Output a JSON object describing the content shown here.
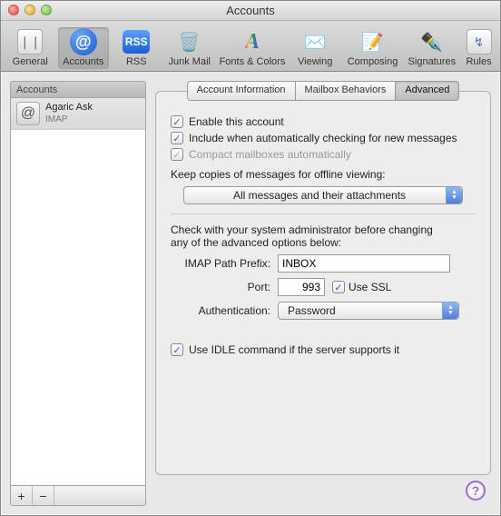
{
  "window": {
    "title": "Accounts"
  },
  "toolbar": {
    "items": [
      {
        "label": "General"
      },
      {
        "label": "Accounts"
      },
      {
        "label": "RSS"
      },
      {
        "label": "Junk Mail"
      },
      {
        "label": "Fonts & Colors"
      },
      {
        "label": "Viewing"
      },
      {
        "label": "Composing"
      },
      {
        "label": "Signatures"
      },
      {
        "label": "Rules"
      }
    ],
    "rss_badge": "RSS"
  },
  "sidebar": {
    "header": "Accounts",
    "items": [
      {
        "name": "Agaric Ask",
        "type": "IMAP"
      }
    ],
    "add": "+",
    "remove": "−"
  },
  "tabs": {
    "items": [
      {
        "label": "Account Information"
      },
      {
        "label": "Mailbox Behaviors"
      },
      {
        "label": "Advanced"
      }
    ],
    "selected": 2
  },
  "advanced": {
    "enable": "Enable this account",
    "include": "Include when automatically checking for new messages",
    "compact": "Compact mailboxes automatically",
    "offline_caption": "Keep copies of messages for offline viewing:",
    "offline_value": "All messages and their attachments",
    "admin_note_1": "Check with your system administrator before changing",
    "admin_note_2": "any of the advanced options below:",
    "imap_prefix_label": "IMAP Path Prefix:",
    "imap_prefix_value": "INBOX",
    "port_label": "Port:",
    "port_value": "993",
    "use_ssl": "Use SSL",
    "auth_label": "Authentication:",
    "auth_value": "Password",
    "idle": "Use IDLE command if the server supports it"
  },
  "help": "?"
}
